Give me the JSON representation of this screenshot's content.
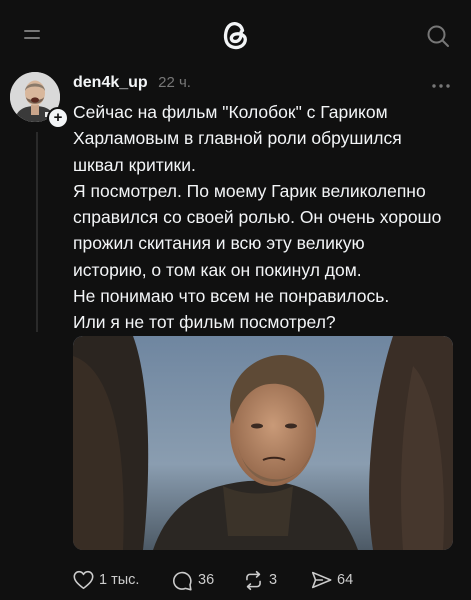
{
  "post": {
    "username": "den4k_up",
    "time": "22 ч.",
    "text_lines": [
      "Сейчас на фильм \"Колобок\" с Гариком",
      "Харламовым в главной роли обрушился",
      "шквал критики.",
      "Я посмотрел. По моему Гарик великолепно",
      "справился со своей ролью. Он очень хорошо",
      "прожил скитания и всю эту великую",
      "историю, о том как он покинул дом.",
      "Не понимаю что всем не понравилось.",
      "Или я не тот фильм посмотрел?"
    ],
    "plus_badge": "+"
  },
  "actions": {
    "likes": "1 тыс.",
    "replies": "36",
    "reposts": "3",
    "shares": "64"
  },
  "icons": {
    "menu": "menu-icon",
    "logo": "threads-logo-icon",
    "search": "search-icon",
    "more": "more-icon",
    "like": "heart-icon",
    "reply": "comment-icon",
    "repost": "repost-icon",
    "share": "send-icon"
  },
  "colors": {
    "background": "#101010",
    "text": "#f3f5f7",
    "muted": "#777777"
  }
}
